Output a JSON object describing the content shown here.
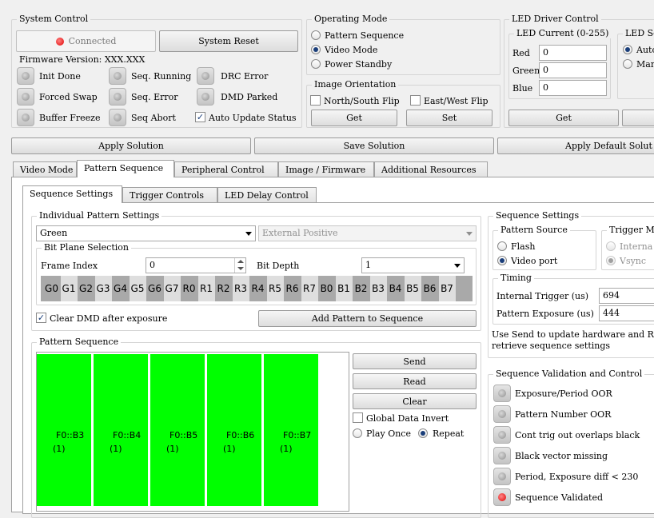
{
  "system_control": {
    "title": "System Control",
    "connected_label": "Connected",
    "reset_label": "System Reset",
    "firmware": "Firmware Version: XXX.XXX",
    "status": [
      {
        "label": "Init Done"
      },
      {
        "label": "Seq. Running"
      },
      {
        "label": "DRC Error"
      },
      {
        "label": "Forced Swap"
      },
      {
        "label": "Seq. Error"
      },
      {
        "label": "DMD Parked"
      },
      {
        "label": "Buffer Freeze"
      },
      {
        "label": "Seq Abort"
      }
    ],
    "auto_update_label": "Auto Update Status"
  },
  "operating_mode": {
    "title": "Operating Mode",
    "options": [
      "Pattern Sequence",
      "Video Mode",
      "Power Standby"
    ],
    "selected": "Video Mode"
  },
  "image_orientation": {
    "title": "Image Orientation",
    "ns_flip": "North/South Flip",
    "ew_flip": "East/West Flip",
    "get_label": "Get",
    "set_label": "Set"
  },
  "led_driver": {
    "title": "LED Driver Control",
    "current_title": "LED Current (0-255)",
    "red_label": "Red",
    "red_value": "0",
    "green_label": "Green",
    "green_value": "0",
    "blue_label": "Blue",
    "blue_value": "0",
    "get_label": "Get",
    "sel_title": "LED Se",
    "auto_label": "Auto",
    "manual_label": "Manu"
  },
  "solution_bar": {
    "apply": "Apply Solution",
    "save": "Save Solution",
    "apply_default": "Apply Default Solut"
  },
  "main_tabs": [
    "Video Mode",
    "Pattern Sequence",
    "Peripheral Control",
    "Image / Firmware",
    "Additional Resources"
  ],
  "sub_tabs": [
    "Sequence Settings",
    "Trigger Controls",
    "LED Delay Control"
  ],
  "individual": {
    "title": "Individual Pattern Settings",
    "color": "Green",
    "trigger": "External Positive",
    "bitplane_title": "Bit Plane Selection",
    "frame_index_label": "Frame Index",
    "frame_index_value": "0",
    "bit_depth_label": "Bit Depth",
    "bit_depth_value": "1",
    "bits": [
      "G0",
      "G1",
      "G2",
      "G3",
      "G4",
      "G5",
      "G6",
      "G7",
      "R0",
      "R1",
      "R2",
      "R3",
      "R4",
      "R5",
      "R6",
      "R7",
      "B0",
      "B1",
      "B2",
      "B3",
      "B4",
      "B5",
      "B6",
      "B7"
    ],
    "clear_dmd_label": "Clear DMD after exposure",
    "add_pattern_label": "Add Pattern to Sequence"
  },
  "pattern_sequence": {
    "title": "Pattern Sequence",
    "color": "#00ff00",
    "patterns": [
      {
        "name": "F0::B3",
        "count": "(1)"
      },
      {
        "name": "F0::B4",
        "count": "(1)"
      },
      {
        "name": "F0::B5",
        "count": "(1)"
      },
      {
        "name": "F0::B6",
        "count": "(1)"
      },
      {
        "name": "F0::B7",
        "count": "(1)"
      }
    ],
    "send_label": "Send",
    "read_label": "Read",
    "clear_label": "Clear",
    "invert_label": "Global Data Invert",
    "play_once_label": "Play Once",
    "repeat_label": "Repeat"
  },
  "sequence_settings": {
    "title": "Sequence Settings",
    "source_title": "Pattern Source",
    "flash_label": "Flash",
    "video_port_label": "Video port",
    "trigger_title": "Trigger Mo",
    "internal_label": "Interna",
    "vsync_label": "Vsync",
    "timing_title": "Timing",
    "internal_trigger_label": "Internal Trigger (us)",
    "internal_trigger_value": "694",
    "exposure_label": "Pattern Exposure (us)",
    "exposure_value": "444",
    "hint_line1": "Use Send to update hardware and Re",
    "hint_line2": "retrieve sequence settings"
  },
  "validation": {
    "title": "Sequence Validation and Control",
    "items": [
      {
        "label": "Exposure/Period OOR"
      },
      {
        "label": "Pattern Number OOR"
      },
      {
        "label": "Cont trig out overlaps black"
      },
      {
        "label": "Black vector missing"
      },
      {
        "label": "Period, Exposure diff < 230"
      },
      {
        "label": "Sequence Validated"
      }
    ]
  }
}
